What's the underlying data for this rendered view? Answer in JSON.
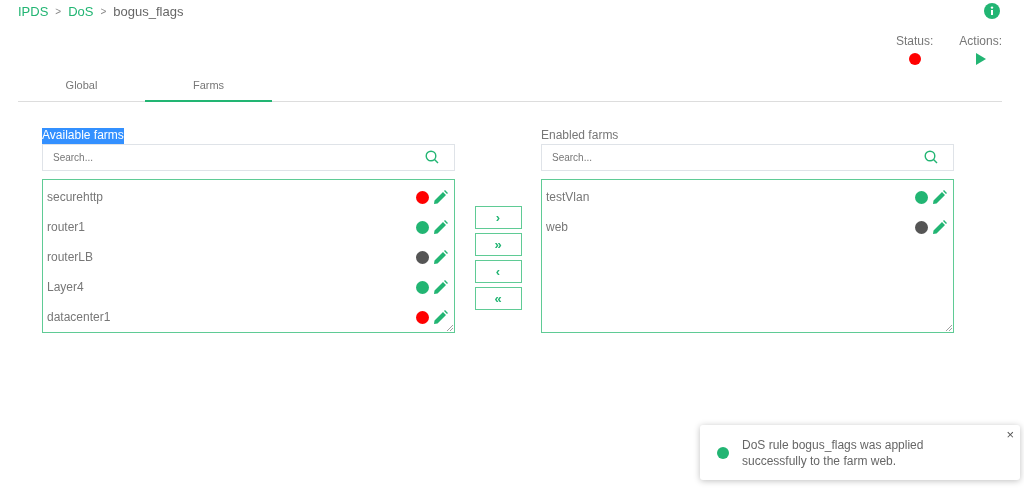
{
  "breadcrumb": [
    {
      "label": "IPDS",
      "link": true
    },
    {
      "label": ">",
      "link": false
    },
    {
      "label": "DoS",
      "link": true
    },
    {
      "label": ">",
      "link": false
    },
    {
      "label": "bogus_flags",
      "link": false
    }
  ],
  "status": {
    "label": "Status:",
    "color": "#ff0000"
  },
  "actions": {
    "label": "Actions:"
  },
  "tabs": [
    {
      "label": "Global",
      "selected": false
    },
    {
      "label": "Farms",
      "selected": true
    }
  ],
  "available": {
    "title": "Available farms",
    "highlighted": true,
    "placeholder": "Search...",
    "items": [
      {
        "name": "securehttp",
        "color": "#ff0000"
      },
      {
        "name": "router1",
        "color": "#22b573"
      },
      {
        "name": "routerLB",
        "color": "#555555"
      },
      {
        "name": "Layer4",
        "color": "#22b573"
      },
      {
        "name": "datacenter1",
        "color": "#ff0000"
      }
    ]
  },
  "move_buttons": [
    "›",
    "»",
    "‹",
    "«"
  ],
  "enabled": {
    "title": "Enabled farms",
    "highlighted": false,
    "placeholder": "Search...",
    "items": [
      {
        "name": "testVlan",
        "color": "#22b573"
      },
      {
        "name": "web",
        "color": "#555555"
      }
    ]
  },
  "toast": {
    "message": "DoS rule bogus_flags was applied successfully to the farm web.",
    "color": "#22b573",
    "close": "×"
  }
}
